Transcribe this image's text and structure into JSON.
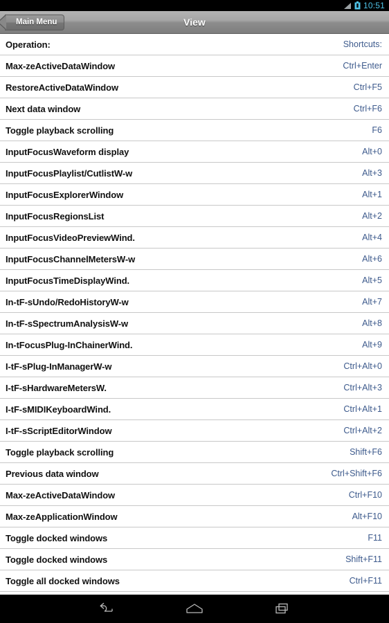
{
  "statusbar": {
    "time": "10:51",
    "icons": [
      "signal-icon",
      "battery-icon"
    ]
  },
  "titlebar": {
    "back_label": "Main Menu",
    "title": "View"
  },
  "colors": {
    "shortcut_blue": "#3d5a8c",
    "operation_black": "#111111",
    "row_separator": "#c8c8c8",
    "titlebar_gray": "#8d8d8d",
    "status_clock_blue": "#4fc3e8"
  },
  "list": {
    "header": {
      "operation": "Operation:",
      "shortcut": "Shortcuts:"
    },
    "rows": [
      {
        "operation": "Max-zeActiveDataWindow",
        "shortcut": "Ctrl+Enter"
      },
      {
        "operation": "RestoreActiveDataWindow",
        "shortcut": "Ctrl+F5"
      },
      {
        "operation": "Next data window",
        "shortcut": "Ctrl+F6"
      },
      {
        "operation": "Toggle playback scrolling",
        "shortcut": "F6"
      },
      {
        "operation": "InputFocusWaveform display",
        "shortcut": "Alt+0"
      },
      {
        "operation": "InputFocusPlaylist/CutlistW-w",
        "shortcut": "Alt+3"
      },
      {
        "operation": "InputFocusExplorerWindow",
        "shortcut": "Alt+1"
      },
      {
        "operation": "InputFocusRegionsList",
        "shortcut": "Alt+2"
      },
      {
        "operation": "InputFocusVideoPreviewWind.",
        "shortcut": "Alt+4"
      },
      {
        "operation": "InputFocusChannelMetersW-w",
        "shortcut": "Alt+6"
      },
      {
        "operation": "InputFocusTimeDisplayWind.",
        "shortcut": "Alt+5"
      },
      {
        "operation": "In-tF-sUndo/RedoHistoryW-w",
        "shortcut": "Alt+7"
      },
      {
        "operation": "In-tF-sSpectrumAnalysisW-w",
        "shortcut": "Alt+8"
      },
      {
        "operation": "In-tFocusPlug-InChainerWind.",
        "shortcut": "Alt+9"
      },
      {
        "operation": "I-tF-sPlug-InManagerW-w",
        "shortcut": "Ctrl+Alt+0"
      },
      {
        "operation": "I-tF-sHardwareMetersW.",
        "shortcut": "Ctrl+Alt+3"
      },
      {
        "operation": "I-tF-sMIDIKeyboardWind.",
        "shortcut": "Ctrl+Alt+1"
      },
      {
        "operation": "I-tF-sScriptEditorWindow",
        "shortcut": "Ctrl+Alt+2"
      },
      {
        "operation": "Toggle playback scrolling",
        "shortcut": "Shift+F6"
      },
      {
        "operation": "Previous data window",
        "shortcut": "Ctrl+Shift+F6"
      },
      {
        "operation": "Max-zeActiveDataWindow",
        "shortcut": "Ctrl+F10"
      },
      {
        "operation": "Max-zeApplicationWindow",
        "shortcut": "Alt+F10"
      },
      {
        "operation": "Toggle docked windows",
        "shortcut": "F11"
      },
      {
        "operation": "Toggle docked windows",
        "shortcut": "Shift+F11"
      },
      {
        "operation": "Toggle all docked windows",
        "shortcut": "Ctrl+F11"
      }
    ]
  },
  "navbar": {
    "buttons": [
      {
        "name": "back-icon"
      },
      {
        "name": "home-icon"
      },
      {
        "name": "recents-icon"
      }
    ]
  }
}
